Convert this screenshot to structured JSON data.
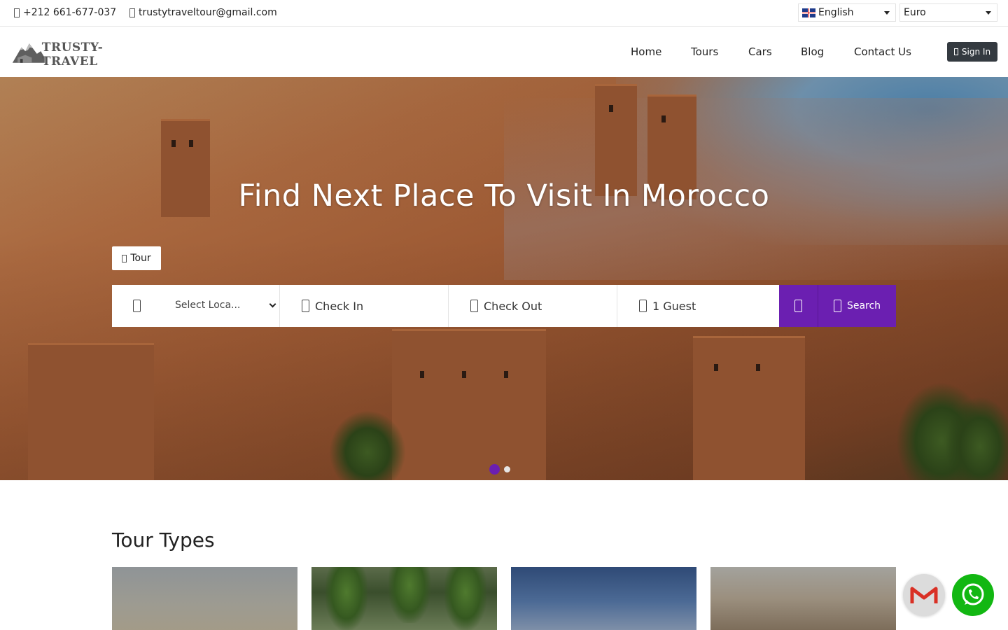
{
  "topbar": {
    "phone": "+212 661-677-037",
    "email": "trustytraveltour@gmail.com",
    "language": "English",
    "currency": "Euro"
  },
  "nav": {
    "logo_text": "TRUSTY-TRAVEL",
    "links": [
      "Home",
      "Tours",
      "Cars",
      "Blog",
      "Contact Us"
    ],
    "signin_label": "Sign In"
  },
  "hero": {
    "title": "Find Next Place To Visit In Morocco",
    "tab_label": "Tour",
    "location_placeholder": "Select Loca...",
    "check_in": "Check In",
    "check_out": "Check Out",
    "guests": "1 Guest",
    "search_label": "Search",
    "slide_count": 2,
    "active_slide": 1
  },
  "tour_types": {
    "title": "Tour Types"
  },
  "colors": {
    "accent": "#6b1fb1",
    "dark_button": "#343a40",
    "whatsapp": "#12b712"
  }
}
